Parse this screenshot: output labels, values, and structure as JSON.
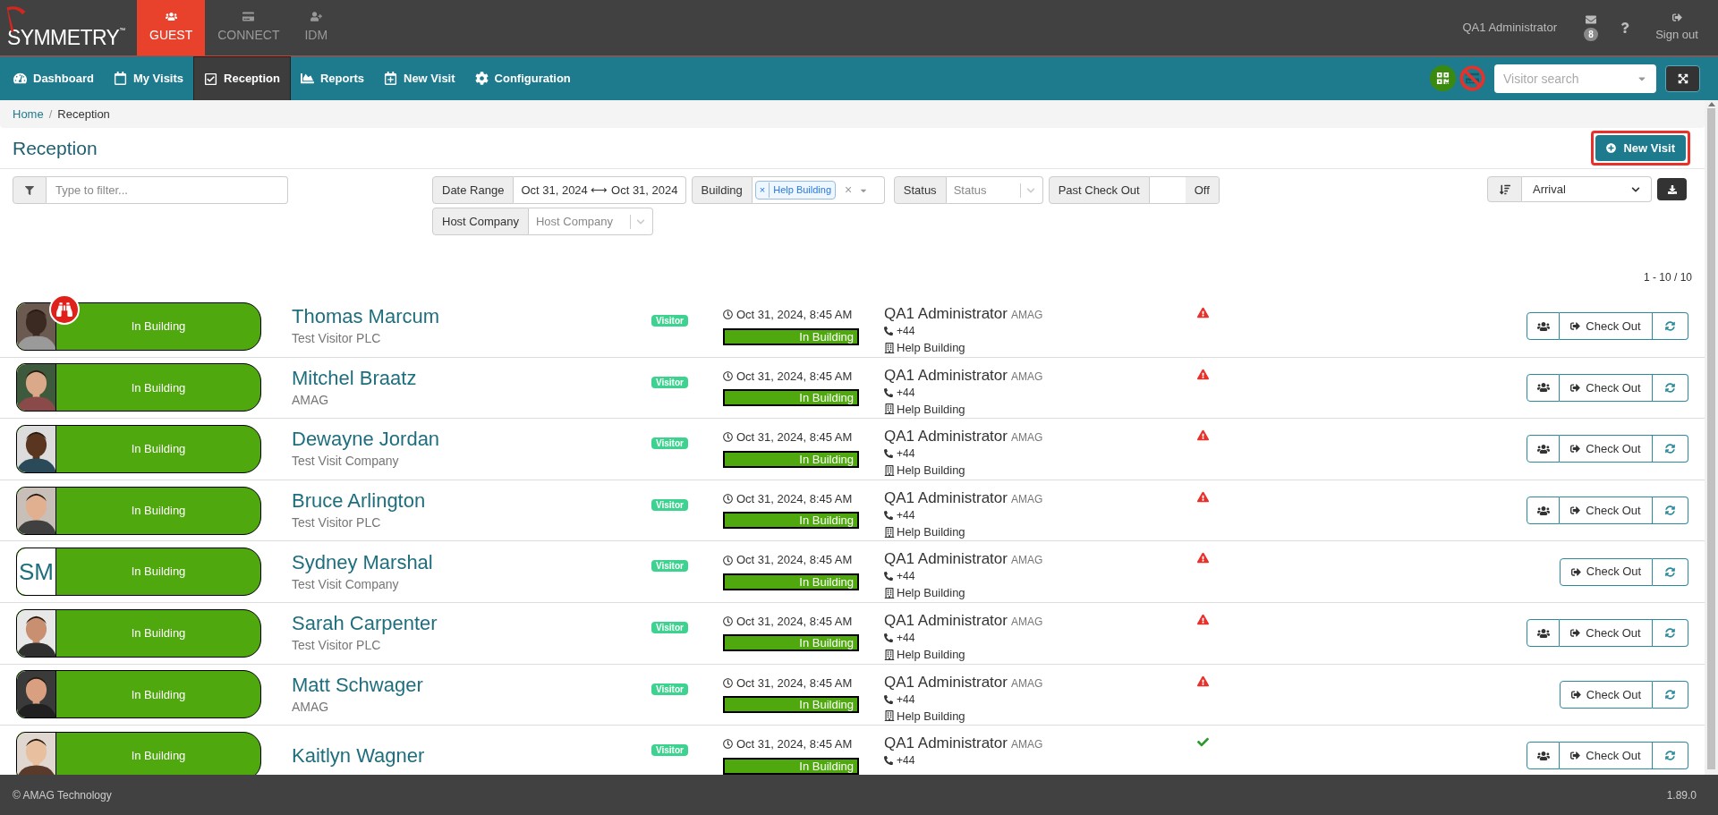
{
  "brand": {
    "name": "SYMMETRY",
    "mark": "™"
  },
  "apps": [
    {
      "label": "GUEST",
      "selected": true
    },
    {
      "label": "CONNECT",
      "selected": false
    },
    {
      "label": "IDM",
      "selected": false
    }
  ],
  "user": {
    "name": "QA1 Administrator",
    "messages": "8",
    "sign_out": "Sign out"
  },
  "nav": [
    {
      "label": "Dashboard",
      "selected": false
    },
    {
      "label": "My Visits",
      "selected": false
    },
    {
      "label": "Reception",
      "selected": true
    },
    {
      "label": "Reports",
      "selected": false
    },
    {
      "label": "New Visit",
      "selected": false
    },
    {
      "label": "Configuration",
      "selected": false
    }
  ],
  "visitor_search": {
    "placeholder": "Visitor search"
  },
  "breadcrumb": {
    "items": [
      "Home",
      "Reception"
    ],
    "separator": "/"
  },
  "page_title": "Reception",
  "new_visit_button": "New Visit",
  "filter": {
    "placeholder": "Type to filter..."
  },
  "filters": {
    "date_range": {
      "label": "Date Range",
      "value": "Oct 31, 2024 ⟷ Oct 31, 2024"
    },
    "building": {
      "label": "Building",
      "tag": "Help Building",
      "tag_remove": "×",
      "clear": "×"
    },
    "status": {
      "label": "Status",
      "placeholder": "Status"
    },
    "past_check_out": {
      "label": "Past Check Out",
      "state": "Off",
      "on": false
    },
    "host_company": {
      "label": "Host Company",
      "placeholder": "Host Company"
    }
  },
  "sort": {
    "value": "Arrival"
  },
  "count": "1 - 10 / 10",
  "visits": [
    {
      "name": "Thomas Marcum",
      "company": "Test Visitor PLC",
      "watchlist": true,
      "status": "In Building",
      "type": "Visitor",
      "time": "Oct 31, 2024, 8:45 AM",
      "time_status": "In Building",
      "host": "QA1 Administrator",
      "host_company": "AMAG",
      "phone": "+44",
      "building": "Help Building",
      "warning": true,
      "group_button": true,
      "check_out": "Check Out"
    },
    {
      "name": "Mitchel Braatz",
      "company": "AMAG",
      "watchlist": false,
      "status": "In Building",
      "type": "Visitor",
      "time": "Oct 31, 2024, 8:45 AM",
      "time_status": "In Building",
      "host": "QA1 Administrator",
      "host_company": "AMAG",
      "phone": "+44",
      "building": "Help Building",
      "warning": true,
      "group_button": true,
      "check_out": "Check Out"
    },
    {
      "name": "Dewayne Jordan",
      "company": "Test Visit Company",
      "watchlist": false,
      "status": "In Building",
      "type": "Visitor",
      "time": "Oct 31, 2024, 8:45 AM",
      "time_status": "In Building",
      "host": "QA1 Administrator",
      "host_company": "AMAG",
      "phone": "+44",
      "building": "Help Building",
      "warning": true,
      "group_button": true,
      "check_out": "Check Out"
    },
    {
      "name": "Bruce Arlington",
      "company": "Test Visitor PLC",
      "watchlist": false,
      "status": "In Building",
      "type": "Visitor",
      "time": "Oct 31, 2024, 8:45 AM",
      "time_status": "In Building",
      "host": "QA1 Administrator",
      "host_company": "AMAG",
      "phone": "+44",
      "building": "Help Building",
      "warning": true,
      "group_button": true,
      "check_out": "Check Out"
    },
    {
      "name": "Sydney Marshal",
      "company": "Test Visit Company",
      "avatar": {
        "kind": "initials",
        "initials": "SM"
      },
      "watchlist": false,
      "status": "In Building",
      "type": "Visitor",
      "time": "Oct 31, 2024, 8:45 AM",
      "time_status": "In Building",
      "host": "QA1 Administrator",
      "host_company": "AMAG",
      "phone": "+44",
      "building": "Help Building",
      "warning": true,
      "group_button": false,
      "check_out": "Check Out"
    },
    {
      "name": "Sarah Carpenter",
      "company": "Test Visitor PLC",
      "watchlist": false,
      "status": "In Building",
      "type": "Visitor",
      "time": "Oct 31, 2024, 8:45 AM",
      "time_status": "In Building",
      "host": "QA1 Administrator",
      "host_company": "AMAG",
      "phone": "+44",
      "building": "Help Building",
      "warning": true,
      "group_button": true,
      "check_out": "Check Out"
    },
    {
      "name": "Matt Schwager",
      "company": "AMAG",
      "watchlist": false,
      "status": "In Building",
      "type": "Visitor",
      "time": "Oct 31, 2024, 8:45 AM",
      "time_status": "In Building",
      "host": "QA1 Administrator",
      "host_company": "AMAG",
      "phone": "+44",
      "building": "Help Building",
      "warning": true,
      "group_button": false,
      "check_out": "Check Out"
    },
    {
      "name": "Kaitlyn Wagner",
      "watchlist": false,
      "status": "In Building",
      "type": "Visitor",
      "time": "Oct 31, 2024, 8:45 AM",
      "time_status": "In Building",
      "host": "QA1 Administrator",
      "host_company": "AMAG",
      "phone": "+44",
      "warning": false,
      "group_button": true,
      "check_out": "Check Out"
    }
  ],
  "footer": {
    "copyright": "© AMAG Technology",
    "version": "1.89.0"
  }
}
